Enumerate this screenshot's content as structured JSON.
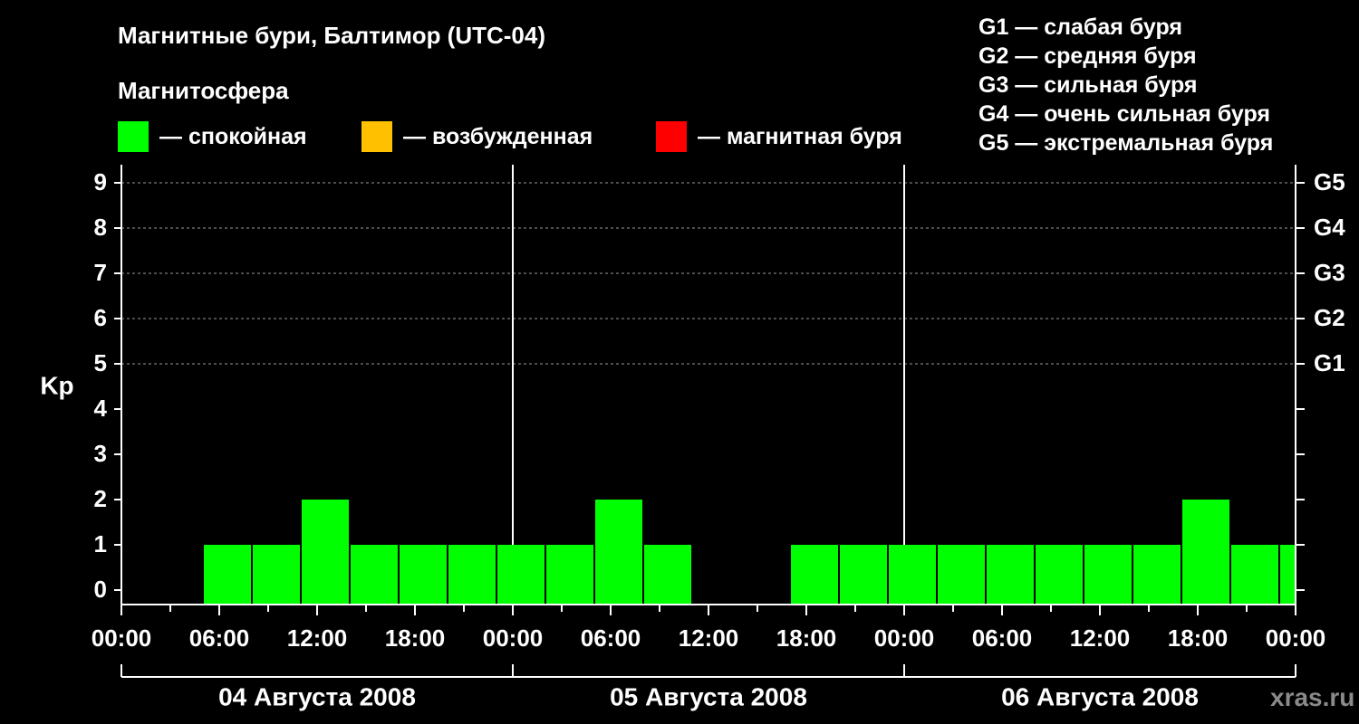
{
  "header": {
    "title": "Магнитные бури, Балтимор (UTC-04)",
    "subtitle": "Магнитосфера"
  },
  "legend": [
    {
      "label": "— спокойная",
      "color": "#00ff00"
    },
    {
      "label": "— возбужденная",
      "color": "#ffc000"
    },
    {
      "label": "— магнитная буря",
      "color": "#ff0000"
    }
  ],
  "g_scale": [
    "G1 — слабая буря",
    "G2 — средняя буря",
    "G3 — сильная буря",
    "G4 — очень сильная буря",
    "G5 — экстремальная буря"
  ],
  "watermark": "xras.ru",
  "chart_data": {
    "type": "bar",
    "ylabel": "Kp",
    "ylim": [
      0,
      9
    ],
    "yticks": [
      0,
      1,
      2,
      3,
      4,
      5,
      6,
      7,
      8,
      9
    ],
    "right_axis_labels": [
      {
        "kp": 5,
        "label": "G1"
      },
      {
        "kp": 6,
        "label": "G2"
      },
      {
        "kp": 7,
        "label": "G3"
      },
      {
        "kp": 8,
        "label": "G4"
      },
      {
        "kp": 9,
        "label": "G5"
      }
    ],
    "gridlines": [
      5,
      6,
      7,
      8,
      9
    ],
    "x_hours_range": [
      0,
      72
    ],
    "xtick_labels": [
      "00:00",
      "06:00",
      "12:00",
      "18:00",
      "00:00",
      "06:00",
      "12:00",
      "18:00",
      "00:00",
      "06:00",
      "12:00",
      "18:00",
      "00:00"
    ],
    "day_labels": [
      "04 Августа 2008",
      "05 Августа 2008",
      "06 Августа 2008"
    ],
    "series": [
      {
        "color": "#00ff00",
        "bars": [
          {
            "start": 5,
            "end": 8,
            "kp": 1
          },
          {
            "start": 8,
            "end": 11,
            "kp": 1
          },
          {
            "start": 11,
            "end": 14,
            "kp": 2
          },
          {
            "start": 14,
            "end": 17,
            "kp": 1
          },
          {
            "start": 17,
            "end": 20,
            "kp": 1
          },
          {
            "start": 20,
            "end": 23,
            "kp": 1
          },
          {
            "start": 23,
            "end": 26,
            "kp": 1
          },
          {
            "start": 26,
            "end": 29,
            "kp": 1
          },
          {
            "start": 29,
            "end": 32,
            "kp": 2
          },
          {
            "start": 32,
            "end": 35,
            "kp": 1
          },
          {
            "start": 41,
            "end": 44,
            "kp": 1
          },
          {
            "start": 44,
            "end": 47,
            "kp": 1
          },
          {
            "start": 47,
            "end": 50,
            "kp": 1
          },
          {
            "start": 50,
            "end": 53,
            "kp": 1
          },
          {
            "start": 53,
            "end": 56,
            "kp": 1
          },
          {
            "start": 56,
            "end": 59,
            "kp": 1
          },
          {
            "start": 59,
            "end": 62,
            "kp": 1
          },
          {
            "start": 62,
            "end": 65,
            "kp": 1
          },
          {
            "start": 65,
            "end": 68,
            "kp": 2
          },
          {
            "start": 68,
            "end": 71,
            "kp": 1
          },
          {
            "start": 71,
            "end": 72,
            "kp": 1
          }
        ]
      }
    ]
  }
}
